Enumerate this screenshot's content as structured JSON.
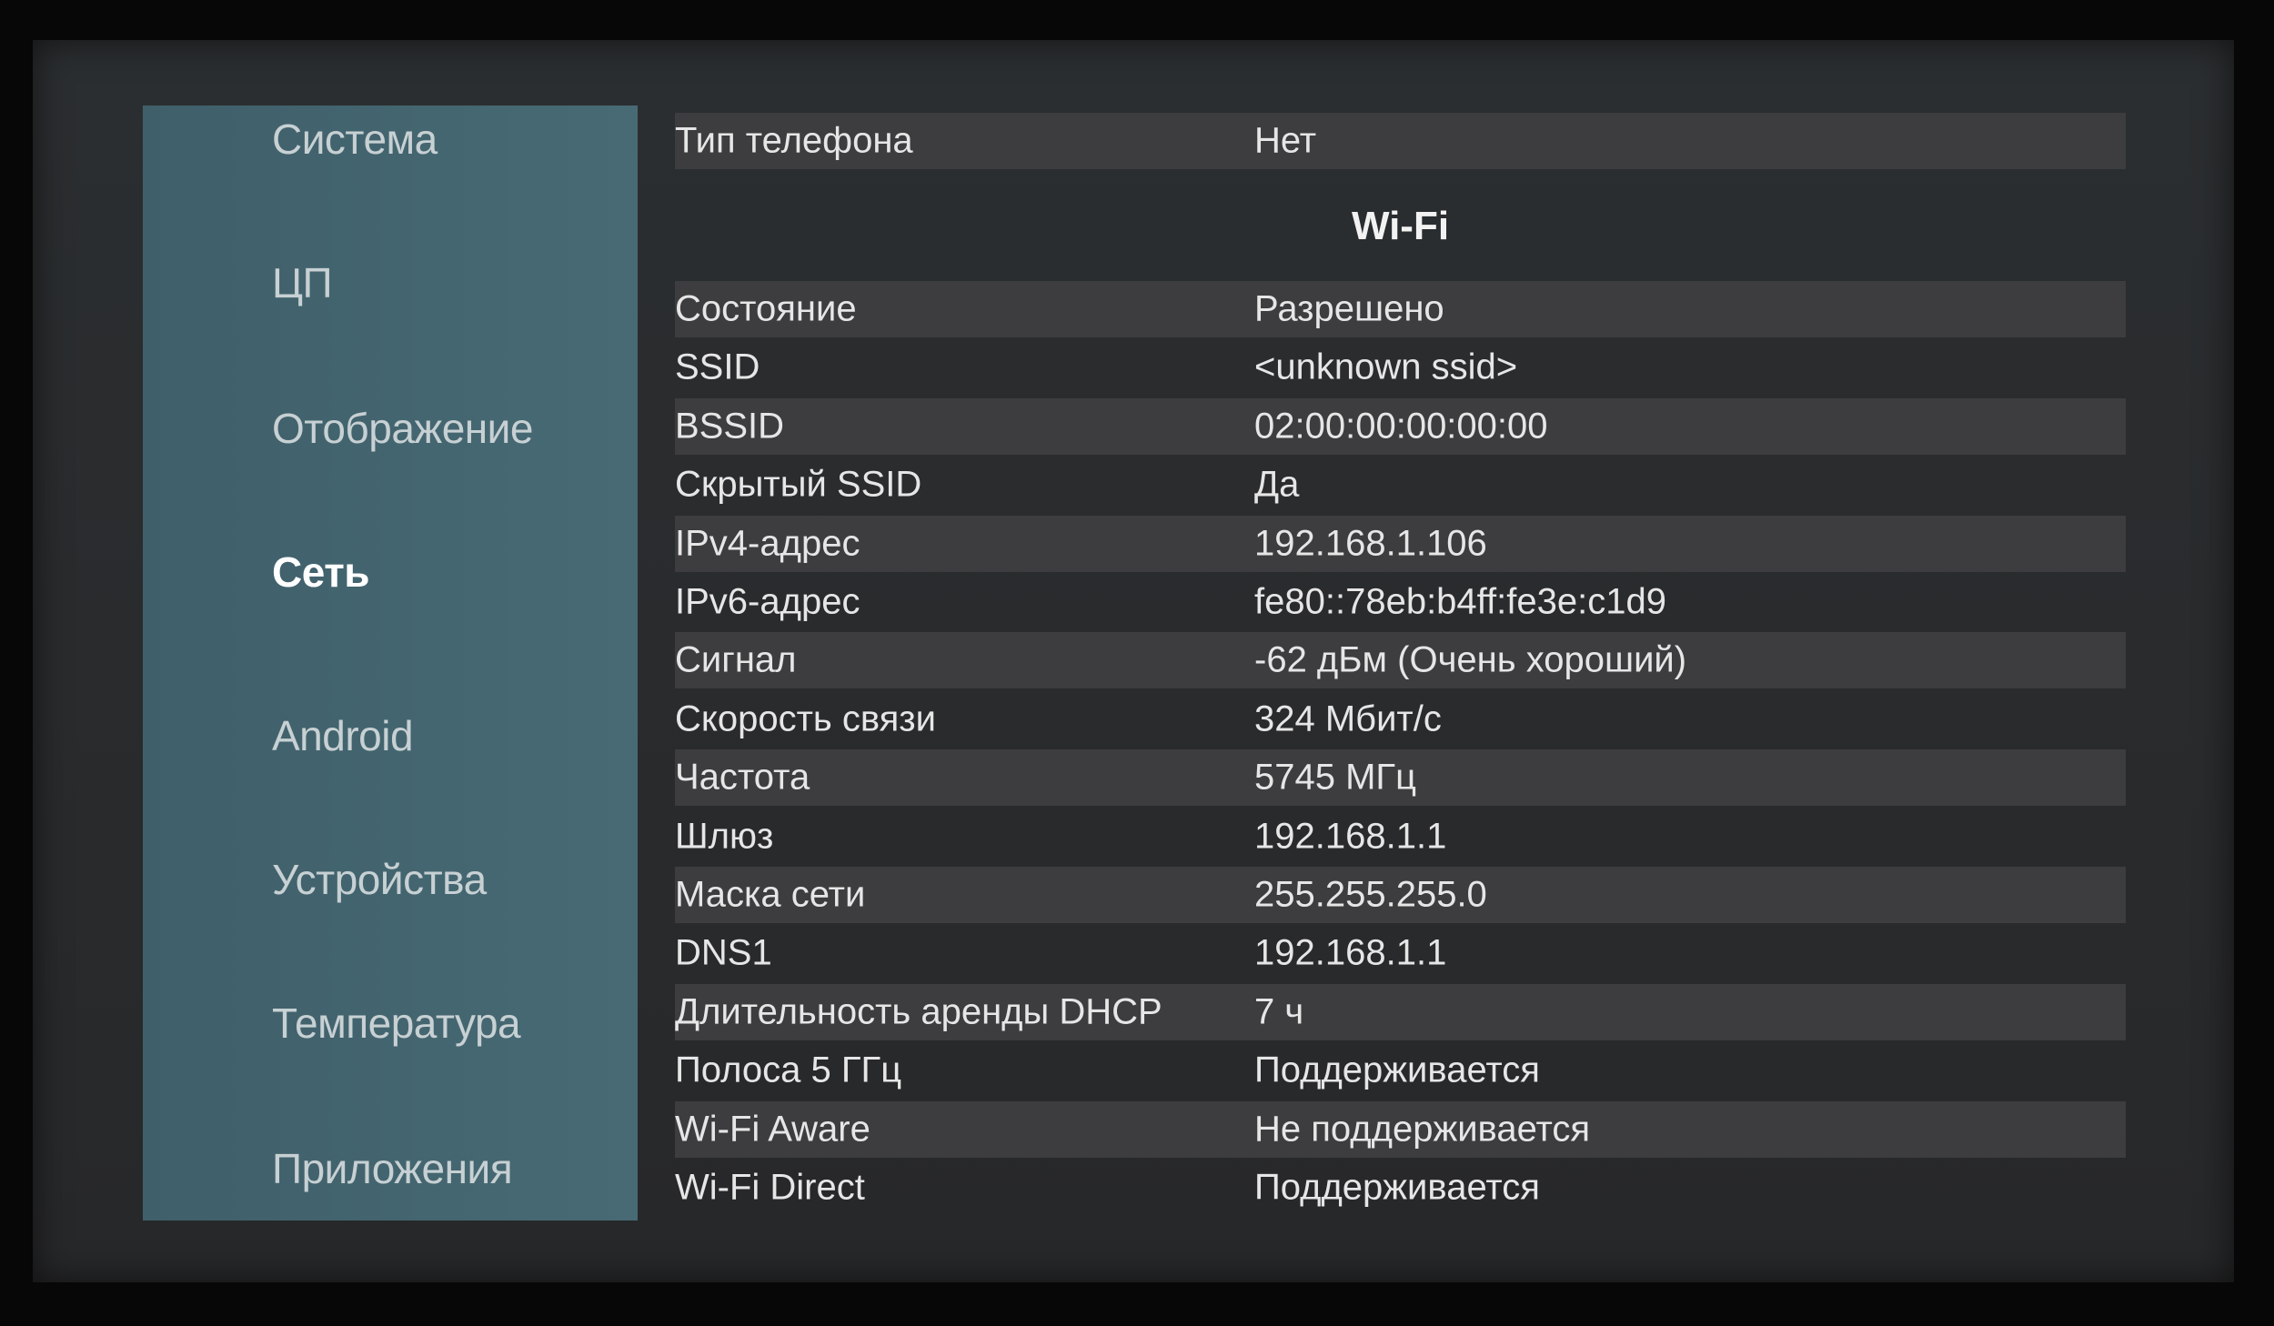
{
  "sidebar": {
    "items": [
      {
        "label": "Система"
      },
      {
        "label": "ЦП"
      },
      {
        "label": "Отображение"
      },
      {
        "label": "Сеть",
        "active": true
      },
      {
        "label": "Android"
      },
      {
        "label": "Устройства"
      },
      {
        "label": "Температура"
      },
      {
        "label": "Приложения"
      }
    ]
  },
  "main": {
    "top_row": {
      "key": "Тип телефона",
      "value": "Нет"
    },
    "section_title": "Wi-Fi",
    "rows": [
      {
        "key": "Состояние",
        "value": "Разрешено"
      },
      {
        "key": "SSID",
        "value": "<unknown ssid>"
      },
      {
        "key": "BSSID",
        "value": "02:00:00:00:00:00"
      },
      {
        "key": "Скрытый SSID",
        "value": "Да"
      },
      {
        "key": "IPv4-адрес",
        "value": "192.168.1.106"
      },
      {
        "key": "IPv6-адрес",
        "value": "fe80::78eb:b4ff:fe3e:c1d9"
      },
      {
        "key": "Сигнал",
        "value": "-62 дБм (Очень хороший)"
      },
      {
        "key": "Скорость связи",
        "value": "324 Мбит/с"
      },
      {
        "key": "Частота",
        "value": "5745 МГц"
      },
      {
        "key": "Шлюз",
        "value": "192.168.1.1"
      },
      {
        "key": "Маска сети",
        "value": "255.255.255.0"
      },
      {
        "key": "DNS1",
        "value": "192.168.1.1"
      },
      {
        "key": "Длительность аренды DHCP",
        "value": "7 ч"
      },
      {
        "key": "Полоса 5 ГГц",
        "value": "Поддерживается"
      },
      {
        "key": "Wi-Fi Aware",
        "value": "Не поддерживается"
      },
      {
        "key": "Wi-Fi Direct",
        "value": "Поддерживается"
      }
    ]
  },
  "colors": {
    "sidebar_bg": "#446670",
    "screen_bg": "#2a2c2e",
    "row_shade": "#3d3d3f",
    "text": "#e6e6e6"
  }
}
